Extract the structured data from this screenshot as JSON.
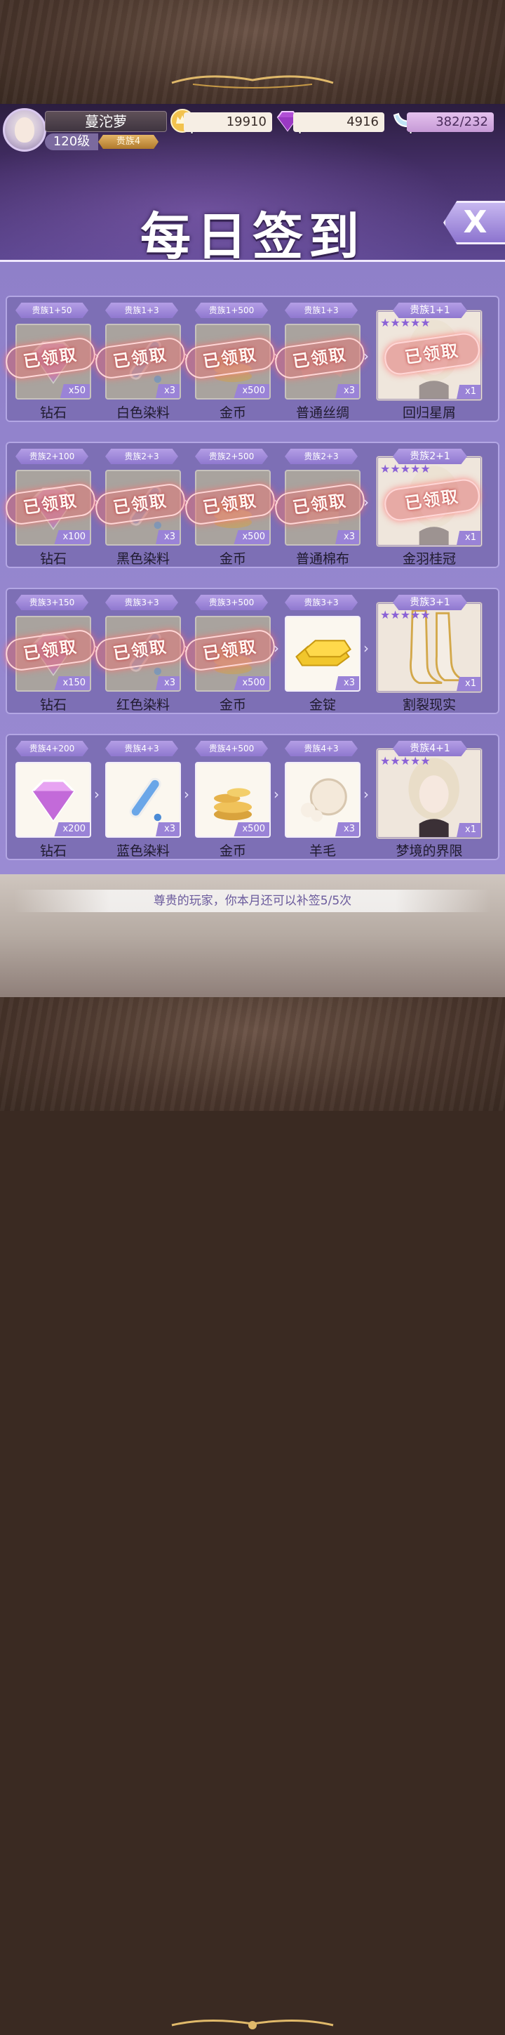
{
  "player": {
    "name": "蔓沱萝",
    "level": "120级",
    "noble": "贵族4"
  },
  "resources": {
    "gold": "19910",
    "gems": "4916",
    "stamina": "382/232"
  },
  "title": "每日签到",
  "close_label": "X",
  "rows": [
    {
      "items": [
        {
          "tag": "贵族1+50",
          "qty": "x50",
          "name": "钻石",
          "claimed": true,
          "icon": "diamond-icon"
        },
        {
          "tag": "贵族1+3",
          "qty": "x3",
          "name": "白色染料",
          "claimed": true,
          "icon": "dye-icon"
        },
        {
          "tag": "贵族1+500",
          "qty": "x500",
          "name": "金币",
          "claimed": true,
          "icon": "coins-icon"
        },
        {
          "tag": "贵族1+3",
          "qty": "x3",
          "name": "普通丝绸",
          "claimed": true,
          "icon": "silk-icon"
        },
        {
          "tag": "贵族1+1",
          "qty": "x1",
          "name": "回归星屑",
          "claimed": true,
          "icon": "card-portrait-icon"
        }
      ]
    },
    {
      "items": [
        {
          "tag": "贵族2+100",
          "qty": "x100",
          "name": "钻石",
          "claimed": true,
          "icon": "diamond-icon"
        },
        {
          "tag": "贵族2+3",
          "qty": "x3",
          "name": "黑色染料",
          "claimed": true,
          "icon": "dye-icon"
        },
        {
          "tag": "贵族2+500",
          "qty": "x500",
          "name": "金币",
          "claimed": true,
          "icon": "coins-icon"
        },
        {
          "tag": "贵族2+3",
          "qty": "x3",
          "name": "普通棉布",
          "claimed": true,
          "icon": "cotton-icon"
        },
        {
          "tag": "贵族2+1",
          "qty": "x1",
          "name": "金羽桂冠",
          "claimed": true,
          "icon": "card-portrait-icon"
        }
      ]
    },
    {
      "items": [
        {
          "tag": "贵族3+150",
          "qty": "x150",
          "name": "钻石",
          "claimed": true,
          "icon": "diamond-icon"
        },
        {
          "tag": "贵族3+3",
          "qty": "x3",
          "name": "红色染料",
          "claimed": true,
          "icon": "dye-icon"
        },
        {
          "tag": "贵族3+500",
          "qty": "x500",
          "name": "金币",
          "claimed": true,
          "icon": "coins-icon"
        },
        {
          "tag": "贵族3+3",
          "qty": "x3",
          "name": "金锭",
          "claimed": false,
          "icon": "gold-ingot-icon"
        },
        {
          "tag": "贵族3+1",
          "qty": "x1",
          "name": "割裂现实",
          "claimed": false,
          "icon": "card-boots-icon"
        }
      ]
    },
    {
      "items": [
        {
          "tag": "贵族4+200",
          "qty": "x200",
          "name": "钻石",
          "claimed": false,
          "icon": "diamond-icon"
        },
        {
          "tag": "贵族4+3",
          "qty": "x3",
          "name": "蓝色染料",
          "claimed": false,
          "icon": "dye-icon"
        },
        {
          "tag": "贵族4+500",
          "qty": "x500",
          "name": "金币",
          "claimed": false,
          "icon": "coins-icon"
        },
        {
          "tag": "贵族4+3",
          "qty": "x3",
          "name": "羊毛",
          "claimed": false,
          "icon": "wool-icon"
        },
        {
          "tag": "贵族4+1",
          "qty": "x1",
          "name": "梦境的界限",
          "claimed": false,
          "icon": "card-portrait-icon"
        }
      ]
    }
  ],
  "claimed_label": "已领取",
  "tip": "尊贵的玩家，你本月还可以补签5/5次",
  "colors": {
    "panel": "#9a8bd3",
    "row": "#7d6fb5",
    "tag": "#9f88da",
    "claimed_stamp": "#e07878"
  }
}
